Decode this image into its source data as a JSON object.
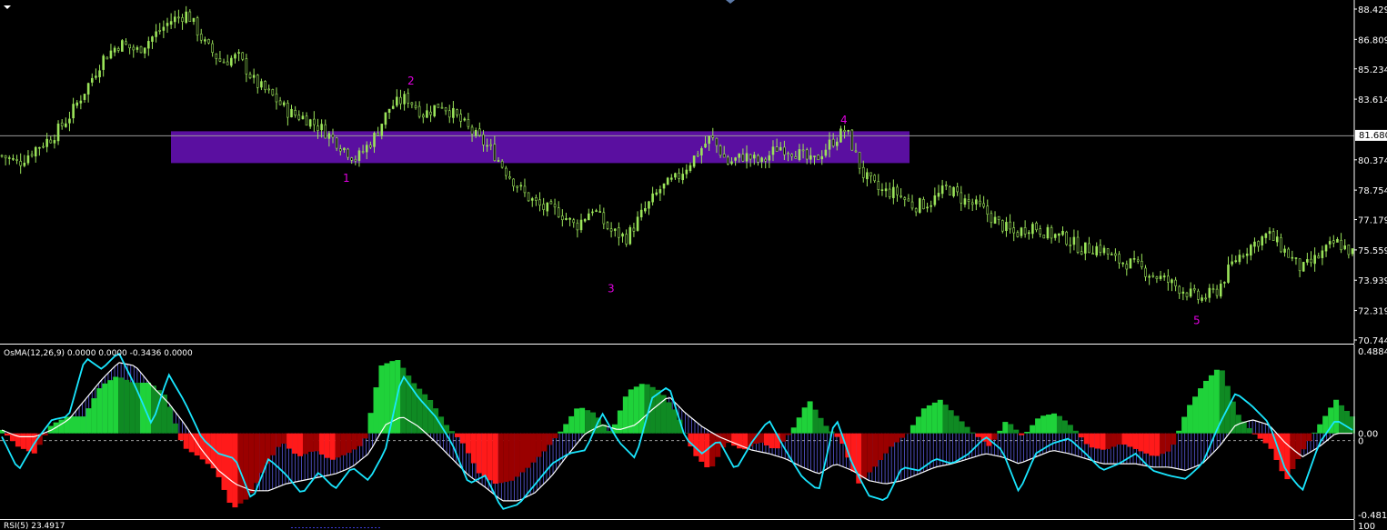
{
  "colors": {
    "background": "#000000",
    "candle": "#9be45a",
    "zone": "#5a0fa0",
    "wave_labels": "#e000e0",
    "osma_pos_bright": "#1fd23a",
    "osma_pos_dark": "#0f8a23",
    "osma_neg_bright": "#ff1a1a",
    "osma_neg_dark": "#9a0000",
    "macd_line": "#19e6ff",
    "signal_line": "#ffffff",
    "hist_lines": "#6a6aff",
    "current_price_line": "#9a9a9a",
    "separator": "#ffffff"
  },
  "indicator": {
    "osma_title": "OsMA(12,26,9) 0.0000 0.0000 -0.3436 0.0000",
    "rsi_title": "RSI(5) 23.4917"
  },
  "chart_data": [
    {
      "type": "candlestick",
      "y_ticks": [
        "88.429",
        "86.809",
        "85.234",
        "83.614",
        "81.680",
        "80.374",
        "78.754",
        "77.179",
        "75.559",
        "73.939",
        "72.319",
        "70.744"
      ],
      "ylim": [
        70.744,
        88.429
      ],
      "current_price": "81.680",
      "zone": {
        "low": 80.2,
        "high": 81.9
      },
      "wave_labels": [
        {
          "label": "1",
          "value": 79.4
        },
        {
          "label": "2",
          "value": 84.6
        },
        {
          "label": "3",
          "value": 73.5
        },
        {
          "label": "4",
          "value": 82.5
        },
        {
          "label": "5",
          "value": 71.8
        }
      ],
      "close_path": [
        80.6,
        80.2,
        81.0,
        81.6,
        82.7,
        84.2,
        85.8,
        86.6,
        86.2,
        87.0,
        87.8,
        88.2,
        86.6,
        85.6,
        85.9,
        84.5,
        83.8,
        82.9,
        82.6,
        82.0,
        81.2,
        80.4,
        81.5,
        83.2,
        83.7,
        82.8,
        83.4,
        82.6,
        81.7,
        80.9,
        79.6,
        78.5,
        77.8,
        77.6,
        76.8,
        77.8,
        76.6,
        76.2,
        77.6,
        78.8,
        79.4,
        80.5,
        81.6,
        80.2,
        80.6,
        80.2,
        81.1,
        80.8,
        80.2,
        81.2,
        82.0,
        79.6,
        78.7,
        78.6,
        77.9,
        78.1,
        78.9,
        78.2,
        77.8,
        77.0,
        76.4,
        76.9,
        76.4,
        76.2,
        75.6,
        75.7,
        75.0,
        74.8,
        74.3,
        73.9,
        73.4,
        72.9,
        73.4,
        75.0,
        75.8,
        76.4,
        75.5,
        74.5,
        75.2,
        76.0,
        75.4
      ]
    },
    {
      "type": "bar",
      "y_ticks": [
        "0.4884",
        "0.00",
        "-0.4812"
      ],
      "ylim": [
        -0.4812,
        0.4884
      ],
      "zero_marker": "0",
      "osma": [
        0.02,
        -0.08,
        -0.12,
        0.05,
        0.1,
        0.1,
        0.28,
        0.34,
        0.3,
        0.3,
        0.22,
        -0.08,
        -0.14,
        -0.22,
        -0.45,
        -0.38,
        -0.2,
        -0.05,
        -0.14,
        -0.1,
        -0.16,
        -0.12,
        -0.06,
        0.4,
        0.44,
        0.3,
        0.2,
        0.05,
        -0.06,
        -0.24,
        -0.3,
        -0.28,
        -0.2,
        -0.1,
        0.02,
        0.16,
        0.12,
        0.0,
        0.25,
        0.3,
        0.25,
        0.12,
        -0.12,
        -0.22,
        -0.05,
        -0.1,
        -0.05,
        -0.1,
        0.02,
        0.2,
        0.05,
        -0.05,
        -0.3,
        -0.2,
        -0.08,
        0.0,
        0.15,
        0.2,
        0.1,
        0.0,
        -0.08,
        0.08,
        -0.02,
        0.1,
        0.12,
        0.04,
        -0.08,
        -0.1,
        -0.06,
        -0.1,
        -0.14,
        -0.1,
        0.15,
        0.3,
        0.4,
        0.12,
        0.0,
        -0.08,
        -0.28,
        -0.1,
        0.05,
        0.2,
        0.1
      ],
      "macd": [
        -0.02,
        -0.22,
        -0.05,
        0.08,
        0.1,
        0.45,
        0.38,
        0.48,
        0.28,
        0.05,
        0.35,
        0.18,
        -0.03,
        -0.12,
        -0.15,
        -0.4,
        -0.15,
        -0.24,
        -0.36,
        -0.23,
        -0.33,
        -0.2,
        -0.28,
        -0.1,
        0.35,
        0.21,
        0.1,
        -0.06,
        -0.3,
        -0.25,
        -0.45,
        -0.42,
        -0.3,
        -0.18,
        -0.12,
        -0.1,
        0.12,
        -0.05,
        -0.15,
        0.21,
        0.28,
        -0.03,
        -0.12,
        -0.04,
        -0.22,
        -0.05,
        0.08,
        -0.1,
        -0.26,
        -0.34,
        0.1,
        -0.18,
        -0.37,
        -0.4,
        -0.2,
        -0.22,
        -0.15,
        -0.18,
        -0.12,
        -0.02,
        -0.1,
        -0.35,
        -0.12,
        -0.06,
        -0.03,
        -0.12,
        -0.22,
        -0.18,
        -0.12,
        -0.22,
        -0.25,
        -0.27,
        -0.18,
        0.05,
        0.24,
        0.16,
        0.06,
        -0.22,
        -0.34,
        -0.06,
        0.08,
        0.02
      ],
      "signal": [
        0.02,
        -0.02,
        -0.02,
        0.02,
        0.08,
        0.2,
        0.32,
        0.42,
        0.4,
        0.28,
        0.18,
        0.05,
        -0.1,
        -0.22,
        -0.3,
        -0.34,
        -0.34,
        -0.3,
        -0.28,
        -0.26,
        -0.24,
        -0.2,
        -0.12,
        0.05,
        0.1,
        0.04,
        -0.05,
        -0.15,
        -0.25,
        -0.32,
        -0.4,
        -0.4,
        -0.35,
        -0.25,
        -0.12,
        0.0,
        0.05,
        0.02,
        0.05,
        0.14,
        0.22,
        0.12,
        0.04,
        -0.02,
        -0.06,
        -0.1,
        -0.12,
        -0.15,
        -0.2,
        -0.24,
        -0.18,
        -0.22,
        -0.28,
        -0.3,
        -0.28,
        -0.24,
        -0.2,
        -0.18,
        -0.15,
        -0.12,
        -0.14,
        -0.18,
        -0.14,
        -0.1,
        -0.12,
        -0.15,
        -0.18,
        -0.18,
        -0.18,
        -0.2,
        -0.2,
        -0.22,
        -0.18,
        -0.08,
        0.05,
        0.08,
        0.05,
        -0.06,
        -0.14,
        -0.08,
        0.0,
        0.0
      ]
    }
  ]
}
